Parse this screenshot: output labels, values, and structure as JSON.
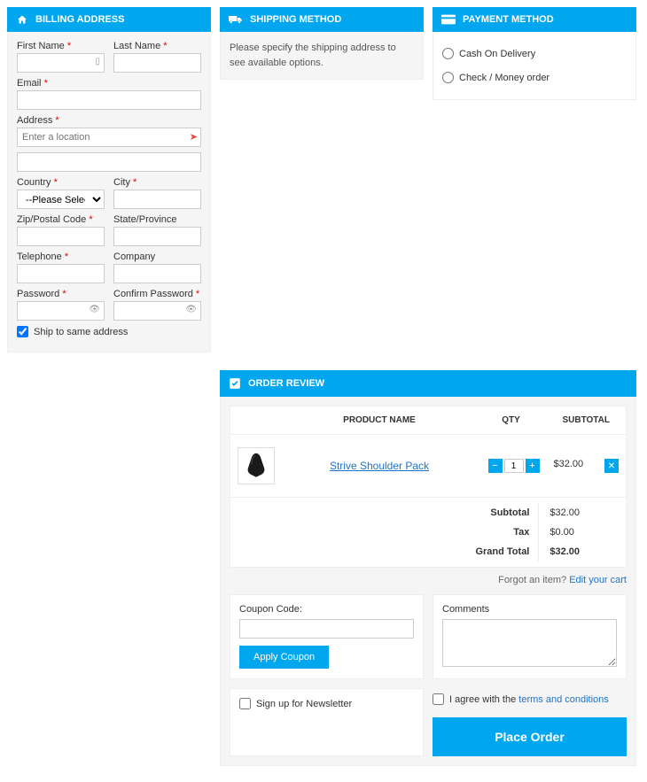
{
  "billing": {
    "title": "BILLING ADDRESS",
    "first_name": "First Name",
    "last_name": "Last Name",
    "email": "Email",
    "address": "Address",
    "address_ph": "Enter a location",
    "country": "Country",
    "country_opt": "--Please Select--",
    "city": "City",
    "zip": "Zip/Postal Code",
    "state": "State/Province",
    "telephone": "Telephone",
    "company": "Company",
    "password": "Password",
    "confirm": "Confirm Password",
    "same": "Ship to same address"
  },
  "shipping": {
    "title": "SHIPPING METHOD",
    "msg": "Please specify the shipping address to see available options."
  },
  "payment": {
    "title": "PAYMENT METHOD",
    "cod": "Cash On Delivery",
    "check": "Check / Money order"
  },
  "review": {
    "title": "ORDER REVIEW",
    "col_name": "PRODUCT NAME",
    "col_qty": "QTY",
    "col_sub": "SUBTOTAL",
    "item_name": "Strive Shoulder Pack",
    "item_qty": "1",
    "item_sub": "$32.00",
    "sub_label": "Subtotal",
    "sub_val": "$32.00",
    "tax_label": "Tax",
    "tax_val": "$0.00",
    "grand_label": "Grand Total",
    "grand_val": "$32.00",
    "forgot": "Forgot an item? ",
    "edit": "Edit your cart",
    "coupon_label": "Coupon Code:",
    "apply": "Apply Coupon",
    "comments": "Comments",
    "newsletter": "Sign up for Newsletter",
    "agree_pre": "I agree with the ",
    "terms": "terms and conditions",
    "place": "Place Order"
  }
}
